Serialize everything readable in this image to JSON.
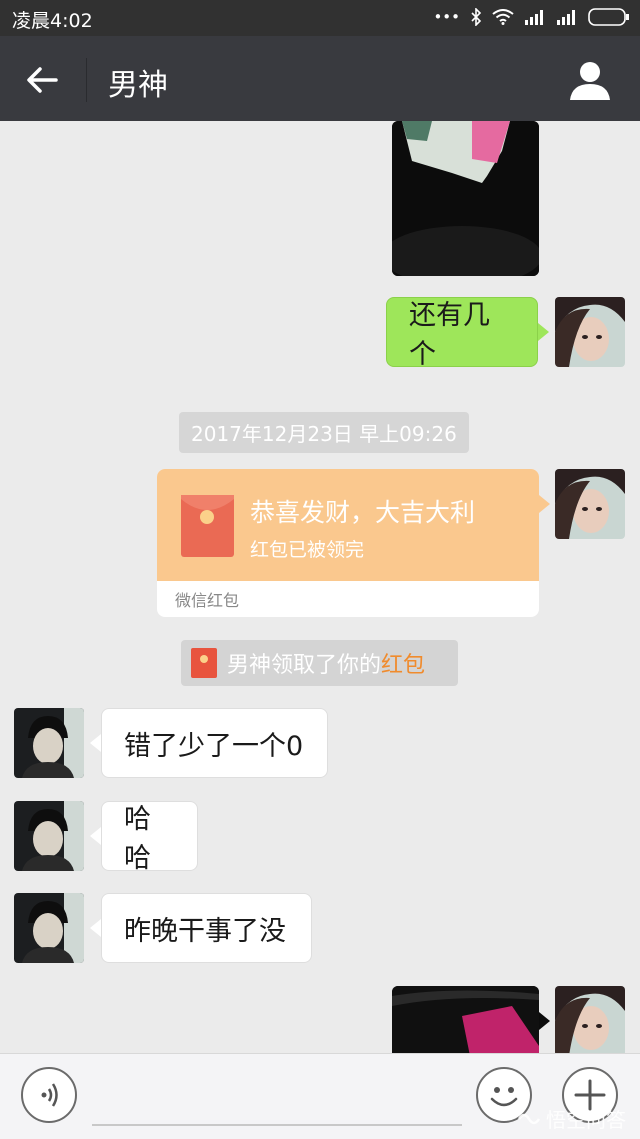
{
  "status_bar": {
    "time": "凌晨4:02"
  },
  "header": {
    "title": "男神"
  },
  "messages": {
    "m1": "还有几个",
    "timestamp": "2017年12月23日 早上09:26",
    "red_packet": {
      "greeting": "恭喜发财，大吉大利",
      "status": "红包已被领完",
      "footer": "微信红包"
    },
    "system_prefix": "男神领取了你的",
    "system_link": "红包",
    "m2": "错了少了一个0",
    "m3": "哈哈",
    "m4": "昨晚干事了没"
  },
  "colors": {
    "green_bubble": "#9ee65a",
    "red_packet_bg": "#fac88e",
    "link": "#f08b2d",
    "title_bar": "#393a3f"
  },
  "icons": [
    "back-arrow-icon",
    "profile-icon",
    "voice-icon",
    "emoji-icon",
    "plus-icon"
  ],
  "watermark": "悟空问答"
}
